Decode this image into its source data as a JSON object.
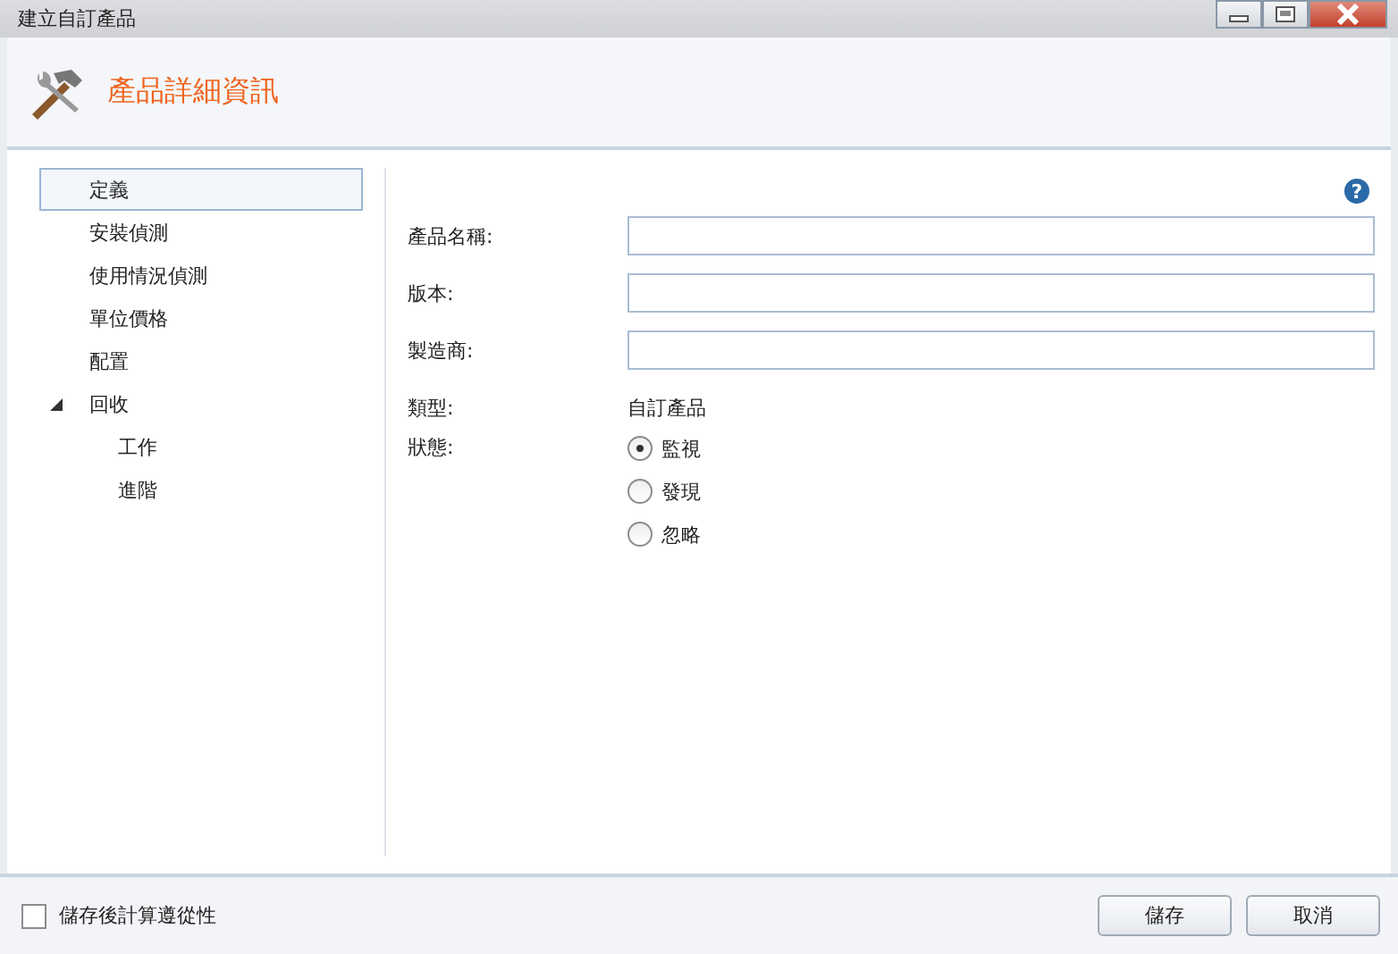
{
  "window": {
    "title": "建立自訂產品"
  },
  "header": {
    "title": "產品詳細資訊"
  },
  "nav": [
    {
      "label": "定義",
      "selected": true
    },
    {
      "label": "安裝偵測",
      "selected": false
    },
    {
      "label": "使用情況偵測",
      "selected": false
    },
    {
      "label": "單位價格",
      "selected": false
    },
    {
      "label": "配置",
      "selected": false
    },
    {
      "label": "回收",
      "selected": false,
      "expanded": true,
      "children": [
        {
          "label": "工作",
          "selected": false
        },
        {
          "label": "進階",
          "selected": false
        }
      ]
    }
  ],
  "form": {
    "help": "?",
    "fields": [
      {
        "label": "產品名稱:"
      },
      {
        "label": "版本:"
      },
      {
        "label": "製造商:"
      }
    ],
    "type": {
      "label": "類型:",
      "value": "自訂產品"
    },
    "status": {
      "label": "狀態:",
      "options": [
        {
          "label": "監視",
          "selected": true
        },
        {
          "label": "發現",
          "selected": false
        },
        {
          "label": "忽略",
          "selected": false
        }
      ]
    }
  },
  "footer": {
    "checkbox": {
      "label": "儲存後計算遵從性",
      "checked": false
    },
    "buttons": [
      "儲存",
      "取消"
    ]
  }
}
